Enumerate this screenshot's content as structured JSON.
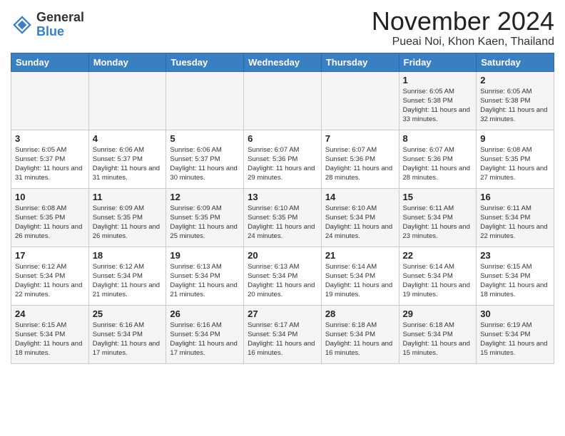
{
  "logo": {
    "general": "General",
    "blue": "Blue"
  },
  "title": "November 2024",
  "location": "Pueai Noi, Khon Kaen, Thailand",
  "days_of_week": [
    "Sunday",
    "Monday",
    "Tuesday",
    "Wednesday",
    "Thursday",
    "Friday",
    "Saturday"
  ],
  "weeks": [
    [
      {
        "day": "",
        "info": ""
      },
      {
        "day": "",
        "info": ""
      },
      {
        "day": "",
        "info": ""
      },
      {
        "day": "",
        "info": ""
      },
      {
        "day": "",
        "info": ""
      },
      {
        "day": "1",
        "info": "Sunrise: 6:05 AM\nSunset: 5:38 PM\nDaylight: 11 hours\nand 33 minutes."
      },
      {
        "day": "2",
        "info": "Sunrise: 6:05 AM\nSunset: 5:38 PM\nDaylight: 11 hours\nand 32 minutes."
      }
    ],
    [
      {
        "day": "3",
        "info": "Sunrise: 6:05 AM\nSunset: 5:37 PM\nDaylight: 11 hours\nand 31 minutes."
      },
      {
        "day": "4",
        "info": "Sunrise: 6:06 AM\nSunset: 5:37 PM\nDaylight: 11 hours\nand 31 minutes."
      },
      {
        "day": "5",
        "info": "Sunrise: 6:06 AM\nSunset: 5:37 PM\nDaylight: 11 hours\nand 30 minutes."
      },
      {
        "day": "6",
        "info": "Sunrise: 6:07 AM\nSunset: 5:36 PM\nDaylight: 11 hours\nand 29 minutes."
      },
      {
        "day": "7",
        "info": "Sunrise: 6:07 AM\nSunset: 5:36 PM\nDaylight: 11 hours\nand 28 minutes."
      },
      {
        "day": "8",
        "info": "Sunrise: 6:07 AM\nSunset: 5:36 PM\nDaylight: 11 hours\nand 28 minutes."
      },
      {
        "day": "9",
        "info": "Sunrise: 6:08 AM\nSunset: 5:35 PM\nDaylight: 11 hours\nand 27 minutes."
      }
    ],
    [
      {
        "day": "10",
        "info": "Sunrise: 6:08 AM\nSunset: 5:35 PM\nDaylight: 11 hours\nand 26 minutes."
      },
      {
        "day": "11",
        "info": "Sunrise: 6:09 AM\nSunset: 5:35 PM\nDaylight: 11 hours\nand 26 minutes."
      },
      {
        "day": "12",
        "info": "Sunrise: 6:09 AM\nSunset: 5:35 PM\nDaylight: 11 hours\nand 25 minutes."
      },
      {
        "day": "13",
        "info": "Sunrise: 6:10 AM\nSunset: 5:35 PM\nDaylight: 11 hours\nand 24 minutes."
      },
      {
        "day": "14",
        "info": "Sunrise: 6:10 AM\nSunset: 5:34 PM\nDaylight: 11 hours\nand 24 minutes."
      },
      {
        "day": "15",
        "info": "Sunrise: 6:11 AM\nSunset: 5:34 PM\nDaylight: 11 hours\nand 23 minutes."
      },
      {
        "day": "16",
        "info": "Sunrise: 6:11 AM\nSunset: 5:34 PM\nDaylight: 11 hours\nand 22 minutes."
      }
    ],
    [
      {
        "day": "17",
        "info": "Sunrise: 6:12 AM\nSunset: 5:34 PM\nDaylight: 11 hours\nand 22 minutes."
      },
      {
        "day": "18",
        "info": "Sunrise: 6:12 AM\nSunset: 5:34 PM\nDaylight: 11 hours\nand 21 minutes."
      },
      {
        "day": "19",
        "info": "Sunrise: 6:13 AM\nSunset: 5:34 PM\nDaylight: 11 hours\nand 21 minutes."
      },
      {
        "day": "20",
        "info": "Sunrise: 6:13 AM\nSunset: 5:34 PM\nDaylight: 11 hours\nand 20 minutes."
      },
      {
        "day": "21",
        "info": "Sunrise: 6:14 AM\nSunset: 5:34 PM\nDaylight: 11 hours\nand 19 minutes."
      },
      {
        "day": "22",
        "info": "Sunrise: 6:14 AM\nSunset: 5:34 PM\nDaylight: 11 hours\nand 19 minutes."
      },
      {
        "day": "23",
        "info": "Sunrise: 6:15 AM\nSunset: 5:34 PM\nDaylight: 11 hours\nand 18 minutes."
      }
    ],
    [
      {
        "day": "24",
        "info": "Sunrise: 6:15 AM\nSunset: 5:34 PM\nDaylight: 11 hours\nand 18 minutes."
      },
      {
        "day": "25",
        "info": "Sunrise: 6:16 AM\nSunset: 5:34 PM\nDaylight: 11 hours\nand 17 minutes."
      },
      {
        "day": "26",
        "info": "Sunrise: 6:16 AM\nSunset: 5:34 PM\nDaylight: 11 hours\nand 17 minutes."
      },
      {
        "day": "27",
        "info": "Sunrise: 6:17 AM\nSunset: 5:34 PM\nDaylight: 11 hours\nand 16 minutes."
      },
      {
        "day": "28",
        "info": "Sunrise: 6:18 AM\nSunset: 5:34 PM\nDaylight: 11 hours\nand 16 minutes."
      },
      {
        "day": "29",
        "info": "Sunrise: 6:18 AM\nSunset: 5:34 PM\nDaylight: 11 hours\nand 15 minutes."
      },
      {
        "day": "30",
        "info": "Sunrise: 6:19 AM\nSunset: 5:34 PM\nDaylight: 11 hours\nand 15 minutes."
      }
    ]
  ]
}
